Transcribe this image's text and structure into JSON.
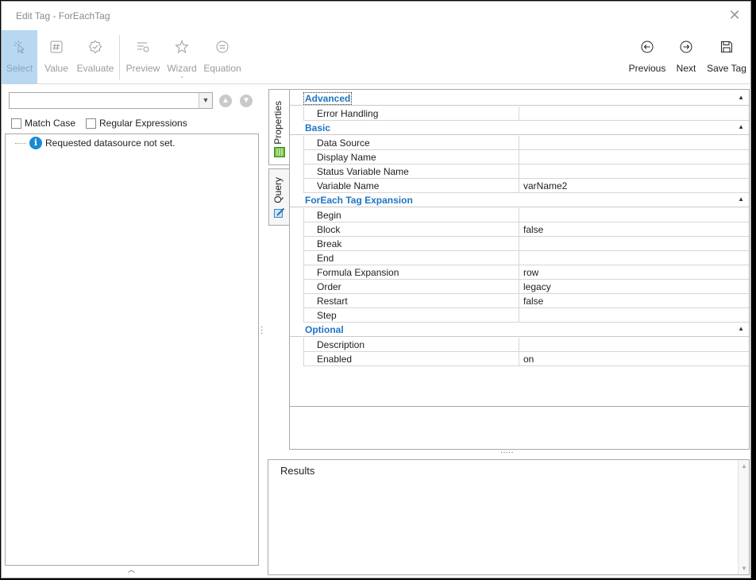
{
  "window": {
    "title": "Edit Tag - ForEachTag",
    "close_glyph": "✕"
  },
  "toolbar": {
    "select": "Select",
    "value": "Value",
    "evaluate": "Evaluate",
    "preview": "Preview",
    "wizard": "Wizard",
    "equation": "Equation",
    "previous": "Previous",
    "next": "Next",
    "save_tag": "Save Tag"
  },
  "left_panel": {
    "search": {
      "value": "",
      "placeholder": ""
    },
    "match_case": "Match Case",
    "regular_expressions": "Regular Expressions",
    "tree_message": "Requested datasource not set."
  },
  "tabs": {
    "properties": "Properties",
    "query": "Query"
  },
  "grid": {
    "categories": [
      {
        "label": "Advanced",
        "rows": [
          {
            "name": "Error Handling",
            "value": ""
          }
        ]
      },
      {
        "label": "Basic",
        "rows": [
          {
            "name": "Data Source",
            "value": ""
          },
          {
            "name": "Display Name",
            "value": ""
          },
          {
            "name": "Status Variable Name",
            "value": ""
          },
          {
            "name": "Variable Name",
            "value": "varName2"
          }
        ]
      },
      {
        "label": "ForEach Tag Expansion",
        "rows": [
          {
            "name": "Begin",
            "value": ""
          },
          {
            "name": "Block",
            "value": "false"
          },
          {
            "name": "Break",
            "value": ""
          },
          {
            "name": "End",
            "value": ""
          },
          {
            "name": "Formula Expansion",
            "value": "row"
          },
          {
            "name": "Order",
            "value": "legacy"
          },
          {
            "name": "Restart",
            "value": "false"
          },
          {
            "name": "Step",
            "value": ""
          }
        ]
      },
      {
        "label": "Optional",
        "rows": [
          {
            "name": "Description",
            "value": ""
          },
          {
            "name": "Enabled",
            "value": "on"
          }
        ]
      }
    ]
  },
  "results": {
    "label": "Results"
  },
  "colors": {
    "accent": "#1f75c2",
    "selected_tool": "#b8d8f1",
    "info": "#1a8ad4"
  }
}
